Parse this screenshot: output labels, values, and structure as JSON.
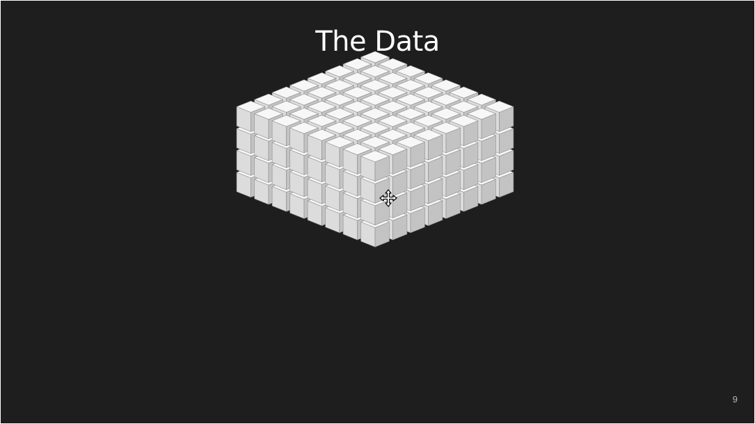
{
  "slide": {
    "title": "The Data",
    "page_number": "9"
  },
  "figure": {
    "description_icon": "stacked-cubes-icon",
    "grid": {
      "columns": 8,
      "rows": 8,
      "layers": 4
    },
    "colors": {
      "background": "#1e1e1e",
      "cube_top": "#f7f7f7",
      "cube_left": "#dcdcdc",
      "cube_right": "#c3c3c3",
      "cube_edge": "#8c8c8c"
    }
  },
  "cursor": {
    "icon": "move-cursor-icon"
  }
}
